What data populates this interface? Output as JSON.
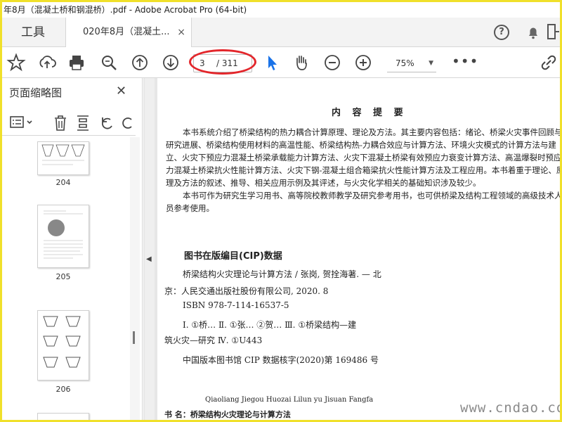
{
  "window": {
    "title": "年8月（混凝土桥和钢混桥）.pdf - Adobe Acrobat Pro (64-bit)"
  },
  "tabs": {
    "tools_label": "工具",
    "doc_label": "020年8月（混凝土...",
    "close_glyph": "×"
  },
  "toolbar": {
    "page_current": "3",
    "page_total": "/ 311",
    "zoom": "75%",
    "zoom_caret": "▼",
    "more": "•••"
  },
  "thumbnail_panel": {
    "title": "页面缩略图",
    "close_glyph": "✕",
    "pages": [
      {
        "label": "204"
      },
      {
        "label": "205"
      },
      {
        "label": "206"
      }
    ]
  },
  "document": {
    "heading": "内 容 提 要",
    "para1": "本书系统介绍了桥梁结构的热力耦合计算原理、理论及方法。其主要内容包括：绪论、桥梁火灾事件回顾与研究进展、桥梁结构使用材料的高温性能、桥梁结构热-力耦合效应与计算方法、环境火灾模式的计算方法与建立、火灾下预应力混凝土桥梁承载能力计算方法、火灾下混凝土桥梁有效预应力衰变计算方法、高温爆裂时预应力混凝土桥梁抗火性能计算方法、火灾下钢-混凝土组合箱梁抗火性能计算方法及工程应用。本书着重于理论、原理及方法的叙述、推导、相关应用示例及其评述，与火灾化学相关的基础知识涉及较少。",
    "para2": "本书可作为研究生学习用书、高等院校教师教学及研究参考用书，也可供桥梁及结构工程领域的高级技术人员参考使用。",
    "cip_title": "图书在版编目(CIP)数据",
    "cip_lines": [
      "桥梁结构火灾理论与计算方法 / 张岗, 贺拴海著. — 北",
      "京：人民交通出版社股份有限公司, 2020. 8",
      "ISBN  978-7-114-16537-5",
      "Ⅰ. ①桥…  Ⅱ. ①张… ②贺…  Ⅲ. ①桥梁结构—建",
      "筑火灾—研究  Ⅳ. ①U443",
      "中国版本图书馆 CIP 数据核字(2020)第 169486 号"
    ],
    "pinyin": "Qiaoliang Jiegou Huozai Lilun yu Jisuan Fangfa",
    "book_line": "书    名：桥梁结构火灾理论与计算方法"
  },
  "watermarks": {
    "bottom_right": "www.cndao.com"
  },
  "colors": {
    "frame_border": "#f0e02a",
    "annotation_oval": "#e3262b",
    "select_arrow": "#1a73e8"
  },
  "icons": [
    "star-icon",
    "upload-icon",
    "print-icon",
    "search-icon",
    "page-up-icon",
    "page-down-icon",
    "select-arrow-icon",
    "hand-icon",
    "zoom-out-icon",
    "zoom-in-icon",
    "share-link-icon",
    "help-icon",
    "bell-icon",
    "sign-in-icon"
  ]
}
